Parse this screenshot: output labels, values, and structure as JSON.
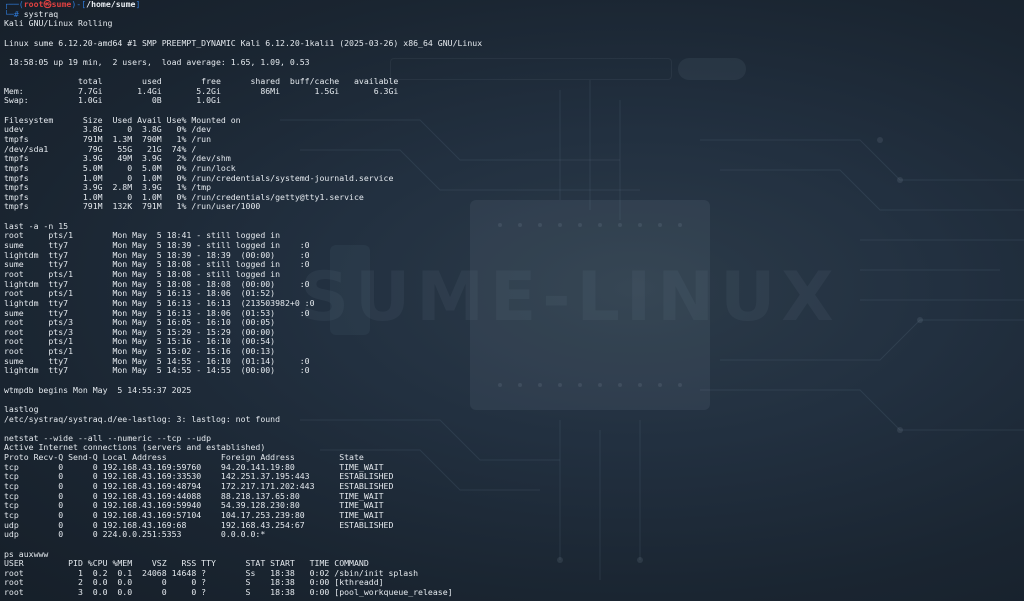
{
  "prompt": {
    "prefix": "┌──(",
    "user": "root㉿sume",
    "mid": ")-[",
    "path": "/home/sume",
    "suffix": "]",
    "line2_prefix": "└─",
    "symbol": "#",
    "command": " systraq"
  },
  "background": {
    "watermark": "SUME-LINUX"
  },
  "lines": [
    "Kali GNU/Linux Rolling",
    "",
    "Linux sume 6.12.20-amd64 #1 SMP PREEMPT_DYNAMIC Kali 6.12.20-1kali1 (2025-03-26) x86_64 GNU/Linux",
    "",
    " 18:58:05 up 19 min,  2 users,  load average: 1.65, 1.09, 0.53",
    "",
    "               total        used        free      shared  buff/cache   available",
    "Mem:           7.7Gi       1.4Gi       5.2Gi        86Mi       1.5Gi       6.3Gi",
    "Swap:          1.0Gi          0B       1.0Gi",
    "",
    "Filesystem      Size  Used Avail Use% Mounted on",
    "udev            3.8G     0  3.8G   0% /dev",
    "tmpfs           791M  1.3M  790M   1% /run",
    "/dev/sda1        79G   55G   21G  74% /",
    "tmpfs           3.9G   49M  3.9G   2% /dev/shm",
    "tmpfs           5.0M     0  5.0M   0% /run/lock",
    "tmpfs           1.0M     0  1.0M   0% /run/credentials/systemd-journald.service",
    "tmpfs           3.9G  2.8M  3.9G   1% /tmp",
    "tmpfs           1.0M     0  1.0M   0% /run/credentials/getty@tty1.service",
    "tmpfs           791M  132K  791M   1% /run/user/1000",
    "",
    "last -a -n 15",
    "root     pts/1        Mon May  5 18:41 - still logged in",
    "sume     tty7         Mon May  5 18:39 - still logged in    :0",
    "lightdm  tty7         Mon May  5 18:39 - 18:39  (00:00)     :0",
    "sume     tty7         Mon May  5 18:08 - still logged in    :0",
    "root     pts/1        Mon May  5 18:08 - still logged in",
    "lightdm  tty7         Mon May  5 18:08 - 18:08  (00:00)     :0",
    "root     pts/1        Mon May  5 16:13 - 18:06  (01:52)",
    "lightdm  tty7         Mon May  5 16:13 - 16:13  (213503982+0 :0",
    "sume     tty7         Mon May  5 16:13 - 18:06  (01:53)     :0",
    "root     pts/3        Mon May  5 16:05 - 16:10  (00:05)",
    "root     pts/3        Mon May  5 15:29 - 15:29  (00:00)",
    "root     pts/1        Mon May  5 15:16 - 16:10  (00:54)",
    "root     pts/1        Mon May  5 15:02 - 15:16  (00:13)",
    "sume     tty7         Mon May  5 14:55 - 16:10  (01:14)     :0",
    "lightdm  tty7         Mon May  5 14:55 - 14:55  (00:00)     :0",
    "",
    "wtmpdb begins Mon May  5 14:55:37 2025",
    "",
    "lastlog",
    "/etc/systraq/systraq.d/ee-lastlog: 3: lastlog: not found",
    "",
    "netstat --wide --all --numeric --tcp --udp",
    "Active Internet connections (servers and established)",
    "Proto Recv-Q Send-Q Local Address           Foreign Address         State",
    "tcp        0      0 192.168.43.169:59760    94.20.141.19:80         TIME_WAIT",
    "tcp        0      0 192.168.43.169:33530    142.251.37.195:443      ESTABLISHED",
    "tcp        0      0 192.168.43.169:48794    172.217.171.202:443     ESTABLISHED",
    "tcp        0      0 192.168.43.169:44088    88.218.137.65:80        TIME_WAIT",
    "tcp        0      0 192.168.43.169:59940    54.39.128.230:80        TIME_WAIT",
    "tcp        0      0 192.168.43.169:57104    104.17.253.239:80       TIME_WAIT",
    "udp        0      0 192.168.43.169:68       192.168.43.254:67       ESTABLISHED",
    "udp        0      0 224.0.0.251:5353        0.0.0.0:*",
    "",
    "ps auxwww",
    "USER         PID %CPU %MEM    VSZ   RSS TTY      STAT START   TIME COMMAND",
    "root           1  0.2  0.1  24068 14648 ?        Ss   18:38   0:02 /sbin/init splash",
    "root           2  0.0  0.0      0     0 ?        S    18:38   0:00 [kthreadd]",
    "root           3  0.0  0.0      0     0 ?        S    18:38   0:00 [pool_workqueue_release]"
  ]
}
